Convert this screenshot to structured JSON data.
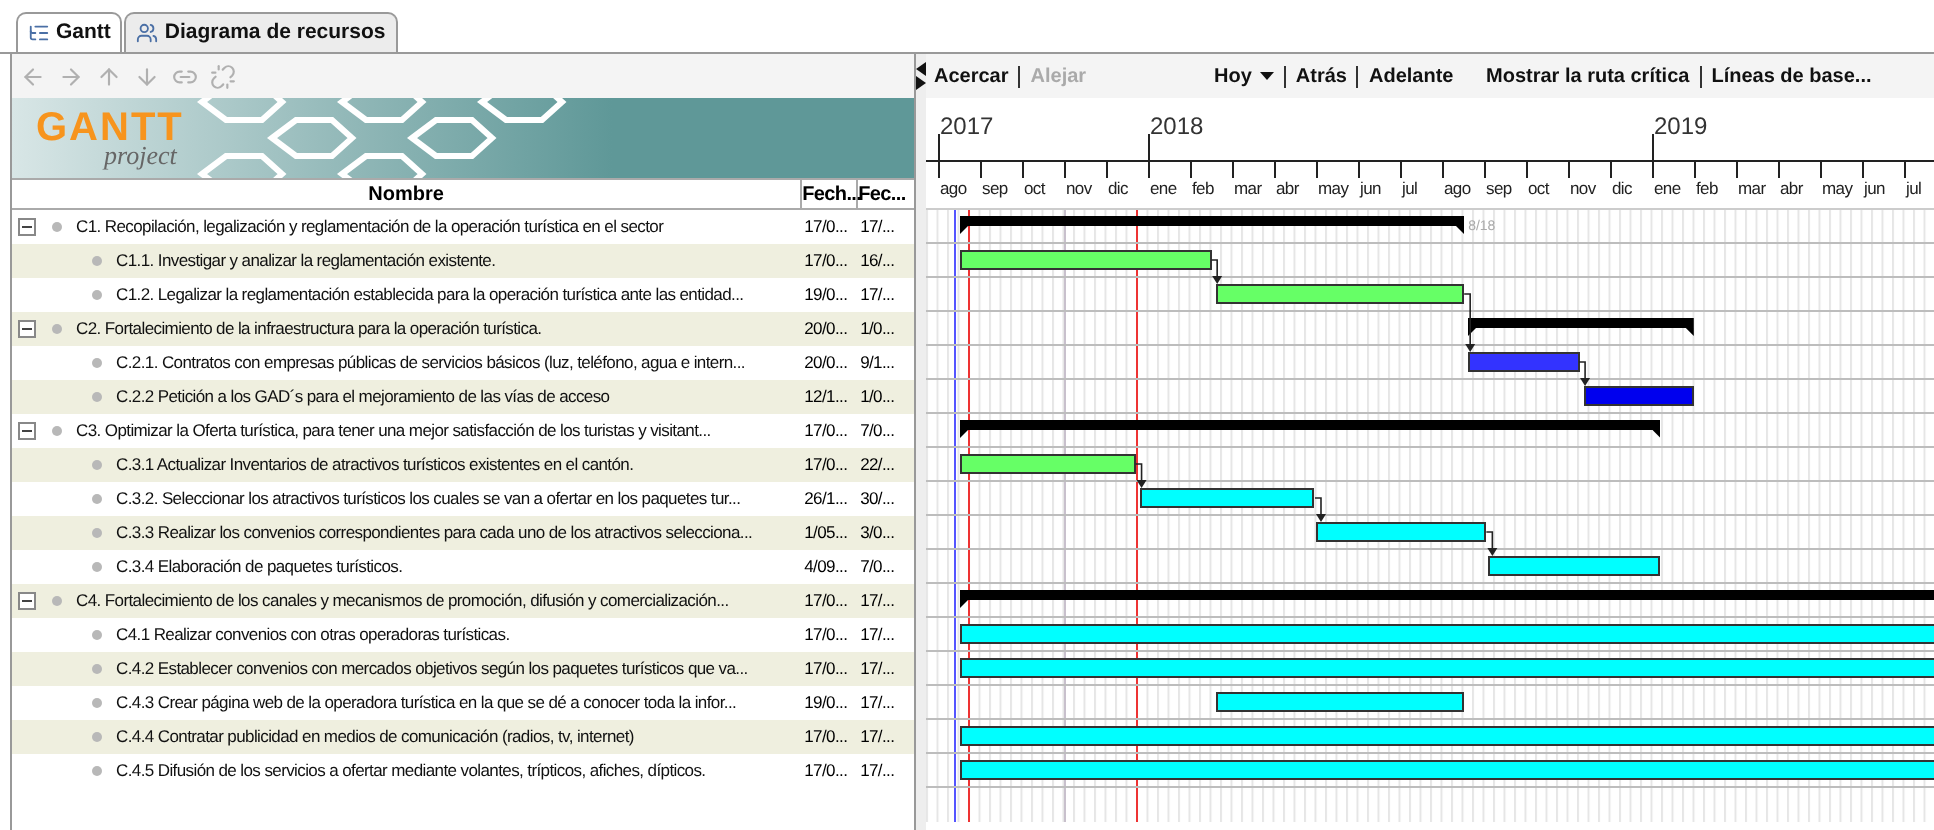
{
  "tabs": [
    {
      "label": "Gantt",
      "kind": "gantt",
      "selected": true
    },
    {
      "label": "Diagrama de recursos",
      "kind": "resources",
      "selected": false
    }
  ],
  "task_toolbar": [
    {
      "kind": "left",
      "disabled": true
    },
    {
      "kind": "right",
      "disabled": true
    },
    {
      "kind": "up",
      "disabled": true
    },
    {
      "kind": "down",
      "disabled": true
    },
    {
      "kind": "link",
      "disabled": true
    },
    {
      "kind": "unlink",
      "disabled": true
    }
  ],
  "logo": {
    "title": "GANTT",
    "subtitle": "project"
  },
  "table": {
    "columns": [
      "Nombre",
      "Fech...",
      "Fec..."
    ],
    "rows": [
      {
        "name": "C1. Recopilación, legalización y reglamentación  de la  operación turística en el sector",
        "start_text": "17/0...",
        "end_text": "17/...",
        "expanded": true,
        "bar": {
          "kind": "summary",
          "start": {
            "level": 0.022
          },
          "end": {
            "level": 0.522
          },
          "label": "8/18"
        },
        "children": [
          {
            "name": "C1.1. Investigar y analizar la reglamentación existente.",
            "start_text": "17/0...",
            "end_text": "16/...",
            "bar": {
              "kind": "task",
              "start": {
                "level": 0.022
              },
              "end": {
                "level": 0.271
              },
              "color": "#66ff66",
              "linked": false
            }
          },
          {
            "name": "C1.2. Legalizar la reglamentación establecida para la operación turística ante las entidad...",
            "start_text": "19/0...",
            "end_text": "17/...",
            "bar": {
              "kind": "task",
              "start": {
                "level": 0.275
              },
              "end": {
                "level": 0.522
              },
              "color": "#66ff66",
              "linked": true
            }
          }
        ]
      },
      {
        "name": "C2.  Fortalecimiento de la infraestructura para la operación turística.",
        "start_text": "20/0...",
        "end_text": "1/0...",
        "expanded": true,
        "bar": {
          "kind": "summary",
          "start": {
            "level": 0.526
          },
          "end": {
            "level": 0.75
          }
        },
        "children": [
          {
            "name": "C.2.1. Contratos con empresas públicas de servicios básicos (luz, teléfono, agua e intern...",
            "start_text": "20/0...",
            "end_text": "9/1...",
            "bar": {
              "kind": "task",
              "start": {
                "level": 0.526
              },
              "end": {
                "level": 0.636
              },
              "color": "#3333ff",
              "linked": true
            }
          },
          {
            "name": "C.2.2 Petición a los GAD´s  para el mejoramiento de las vías de acceso",
            "start_text": "12/1...",
            "end_text": "1/0...",
            "bar": {
              "kind": "task",
              "start": {
                "level": 0.64
              },
              "end": {
                "level": 0.75
              },
              "color": "#0000ee",
              "linked": true
            }
          }
        ]
      },
      {
        "name": "C3.  Optimizar la Oferta turística, para tener una mejor satisfacción de los turistas y visitant...",
        "start_text": "17/0...",
        "end_text": "7/0...",
        "expanded": true,
        "bar": {
          "kind": "summary",
          "start": {
            "level": 0.022
          },
          "end": {
            "level": 0.717
          }
        },
        "children": [
          {
            "name": "C.3.1 Actualizar Inventarios de atractivos turísticos existentes en el cantón.",
            "start_text": "17/0...",
            "end_text": "22/...",
            "bar": {
              "kind": "task",
              "start": {
                "level": 0.022
              },
              "end": {
                "level": 0.196
              },
              "color": "#66ff66",
              "linked": false
            }
          },
          {
            "name": "C.3.2. Seleccionar los atractivos turísticos los cuales se van a ofertar en los paquetes tur...",
            "start_text": "26/1...",
            "end_text": "30/...",
            "bar": {
              "kind": "task",
              "start": {
                "level": 0.201
              },
              "end": {
                "level": 0.374
              },
              "color": "#00ffff",
              "linked": true
            }
          },
          {
            "name": "C.3.3 Realizar los convenios correspondientes para cada uno de los atractivos selecciona...",
            "start_text": "1/05...",
            "end_text": "3/0...",
            "bar": {
              "kind": "task",
              "start": {
                "level": 0.375
              },
              "end": {
                "level": 0.544
              },
              "color": "#00ffff",
              "linked": true
            }
          },
          {
            "name": "C.3.4 Elaboración de paquetes turísticos.",
            "start_text": "4/09...",
            "end_text": "7/0...",
            "bar": {
              "kind": "task",
              "start": {
                "level": 0.546
              },
              "end": {
                "level": 0.717
              },
              "color": "#00ffff",
              "linked": true
            }
          }
        ]
      },
      {
        "name": "C4.  Fortalecimiento de los canales y mecanismos de promoción, difusión y comercialización...",
        "start_text": "17/0...",
        "end_text": "17/...",
        "expanded": true,
        "bar": {
          "kind": "summary",
          "start": {
            "level": 0.022
          }
        },
        "children": [
          {
            "name": "C4.1 Realizar convenios con otras operadoras turísticas.",
            "start_text": "17/0...",
            "end_text": "17/...",
            "bar": {
              "kind": "task",
              "start": {
                "level": 0.022
              },
              "color": "#00ffff",
              "linked": false
            }
          },
          {
            "name": "C.4.2 Establecer convenios con mercados objetivos según los paquetes turísticos que va...",
            "start_text": "17/0...",
            "end_text": "17/...",
            "bar": {
              "kind": "task",
              "start": {
                "level": 0.022
              },
              "color": "#00ffff",
              "linked": false
            }
          },
          {
            "name": "C.4.3 Crear página web de la operadora turística en la que se dé a conocer toda la infor...",
            "start_text": "19/0...",
            "end_text": "17/...",
            "bar": {
              "kind": "task",
              "start": {
                "level": 0.275
              },
              "end": {
                "level": 0.522
              },
              "color": "#00ffff",
              "linked": false
            }
          },
          {
            "name": "C.4.4 Contratar publicidad en medios de comunicación (radios, tv, internet)",
            "start_text": "17/0...",
            "end_text": "17/...",
            "bar": {
              "kind": "task",
              "start": {
                "level": 0.022
              },
              "color": "#00ffff",
              "linked": false
            }
          },
          {
            "name": "C.4.5 Difusión de los servicios a ofertar mediante volantes, trípticos, afiches, dípticos.",
            "start_text": "17/0...",
            "end_text": "17/...",
            "bar": {
              "kind": "task",
              "start": {
                "level": 0.022
              },
              "color": "#00ffff",
              "linked": false
            }
          }
        ]
      }
    ]
  },
  "chart_toolbar": [
    [
      {
        "label": "Acercar",
        "disabled": false
      },
      {
        "label": "Alejar",
        "disabled": true
      }
    ],
    [
      {
        "label": "Hoy",
        "kind": "dropdown",
        "disabled": false
      },
      {
        "label": "Atrás",
        "disabled": false
      },
      {
        "label": "Adelante",
        "disabled": false
      }
    ],
    [
      {
        "label": "Mostrar la ruta crítica",
        "disabled": false
      },
      {
        "label": "Líneas de base...",
        "disabled": false
      }
    ]
  ],
  "timeline": {
    "months": [
      {
        "label": "ago",
        "year": "2017"
      },
      {
        "label": "sep"
      },
      {
        "label": "oct"
      },
      {
        "label": "nov"
      },
      {
        "label": "dic"
      },
      {
        "label": "ene",
        "year": "2018"
      },
      {
        "label": "feb"
      },
      {
        "label": "mar"
      },
      {
        "label": "abr"
      },
      {
        "label": "may"
      },
      {
        "label": "jun"
      },
      {
        "label": "jul"
      },
      {
        "label": "ago"
      },
      {
        "label": "sep"
      },
      {
        "label": "oct"
      },
      {
        "label": "nov"
      },
      {
        "label": "dic"
      },
      {
        "label": "ene",
        "year": "2019"
      },
      {
        "label": "feb"
      },
      {
        "label": "mar"
      },
      {
        "label": "abr"
      },
      {
        "label": "may"
      },
      {
        "label": "jun"
      },
      {
        "label": "jul"
      }
    ],
    "markers": [
      {
        "level": 0.017,
        "color": "#5555ff"
      },
      {
        "level": 0.032,
        "color": "#ee3333"
      },
      {
        "level": 0.126,
        "color": "#c8c0cc"
      },
      {
        "level": 0.199,
        "color": "#ee3333"
      }
    ]
  }
}
